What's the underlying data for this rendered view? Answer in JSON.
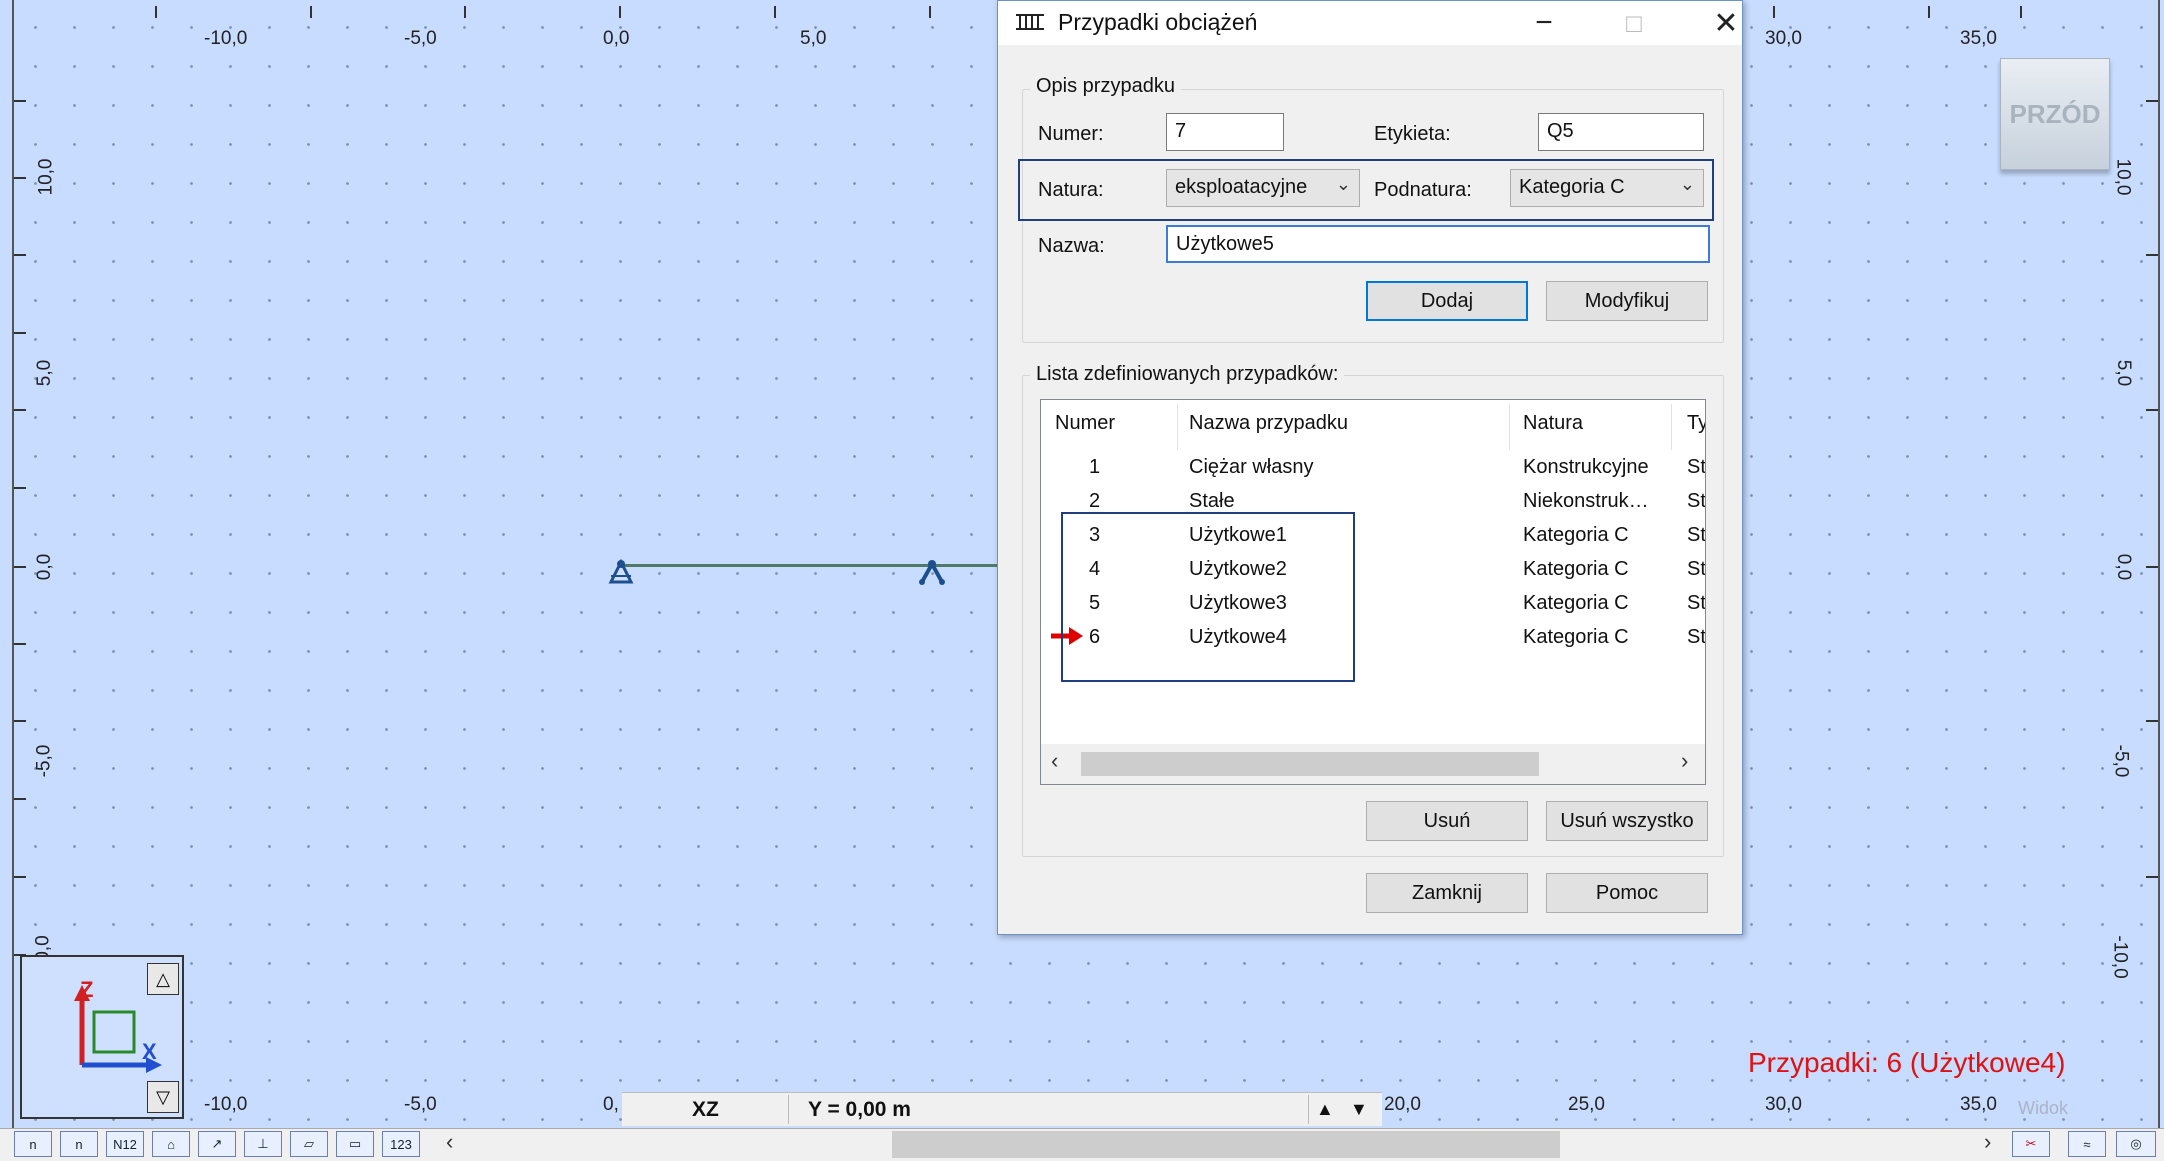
{
  "canvas": {
    "top_ticks": [
      "-10,0",
      "-5,0",
      "0,0",
      "5,0",
      "30,0",
      "35,0"
    ],
    "bottom_ticks": [
      "-10,0",
      "-5,0",
      "0,",
      "20,0",
      "25,0",
      "30,0",
      "35,0"
    ],
    "left_ticks": [
      "10,0",
      "5,0",
      "0,0",
      "-5,0",
      "-10,0"
    ],
    "right_ticks": [
      "10,0",
      "5,0",
      "0,0",
      "-5,0",
      "-10,0"
    ],
    "front_button": "PRZÓD",
    "status_text": "Przypadki: 6 (Użytkowe4)",
    "view_label": "Widok",
    "axis_z": "Z",
    "axis_x": "X"
  },
  "view_bar": {
    "plane": "XZ",
    "coord": "Y = 0,00 m"
  },
  "dialog": {
    "title": "Przypadki obciążeń",
    "group_description": "Opis przypadku",
    "numer_label": "Numer:",
    "numer_value": "7",
    "etykieta_label": "Etykieta:",
    "etykieta_value": "Q5",
    "natura_label": "Natura:",
    "natura_value": "eksploatacyjne",
    "podnatura_label": "Podnatura:",
    "podnatura_value": "Kategoria C",
    "nazwa_label": "Nazwa:",
    "nazwa_value": "Użytkowe5",
    "add_button": "Dodaj",
    "modify_button": "Modyfikuj",
    "group_list": "Lista zdefiniowanych przypadków:",
    "columns": [
      "Numer",
      "Nazwa przypadku",
      "Natura",
      "Ty"
    ],
    "rows": [
      {
        "num": "1",
        "name": "Ciężar własny",
        "nature": "Konstrukcyjne",
        "type": "St"
      },
      {
        "num": "2",
        "name": "Stałe",
        "nature": "Niekonstruk…",
        "type": "St"
      },
      {
        "num": "3",
        "name": "Użytkowe1",
        "nature": "Kategoria C",
        "type": "St"
      },
      {
        "num": "4",
        "name": "Użytkowe2",
        "nature": "Kategoria C",
        "type": "St"
      },
      {
        "num": "5",
        "name": "Użytkowe3",
        "nature": "Kategoria C",
        "type": "St"
      },
      {
        "num": "6",
        "name": "Użytkowe4",
        "nature": "Kategoria C",
        "type": "St"
      }
    ],
    "delete_button": "Usuń",
    "delete_all_button": "Usuń wszystko",
    "close_button": "Zamknij",
    "help_button": "Pomoc"
  },
  "toolbar": {
    "buttons": [
      "n",
      "n",
      "N12",
      "⌂",
      "↗",
      "⊥",
      "▱",
      "▭",
      "123"
    ]
  }
}
